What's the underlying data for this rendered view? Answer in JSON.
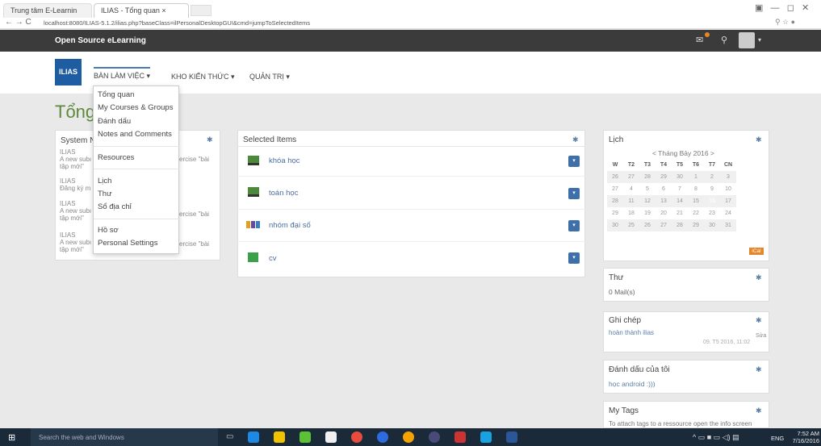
{
  "browser": {
    "tabs": [
      {
        "label": "Trung tâm E-Learnin",
        "active": false
      },
      {
        "label": "ILIAS - Tổng quan",
        "active": true
      }
    ],
    "url": "localhost:8080/ILIAS-5.1.2/ilias.php?baseClass=ilPersonalDesktopGUI&cmd=jumpToSelectedItems"
  },
  "app": {
    "title": "Open Source eLearning",
    "logo": "ILIAS",
    "page_title": "Tổng quan"
  },
  "nav": {
    "items": [
      {
        "label": "BÀN LÀM VIỆC ▾"
      },
      {
        "label": "KHO KIẾN THỨC ▾"
      },
      {
        "label": "QUẢN TRỊ ▾"
      }
    ]
  },
  "dropdown": {
    "group1": [
      "Tổng quan",
      "My Courses & Groups",
      "Đánh dấu",
      "Notes and Comments"
    ],
    "group2": [
      "Resources"
    ],
    "group3": [
      "Lịch",
      "Thư",
      "Sổ địa chỉ"
    ],
    "group4": [
      "Hồ sơ",
      "Personal Settings"
    ]
  },
  "system_panel": {
    "title": "System N",
    "entries": [
      {
        "l1": "ILIAS",
        "l2": "A new subı",
        "l3": "tập mới\"",
        "r": "ercise \"bài"
      },
      {
        "l1": "ILIAS",
        "l2": "Đăng ký m",
        "l3": "",
        "r": ""
      },
      {
        "l1": "ILIAS",
        "l2": "A new subı",
        "l3": "tập mới\"",
        "r": "ercise \"bài"
      },
      {
        "l1": "ILIAS",
        "l2": "A new subı",
        "l3": "tập mới\"",
        "r": "ercise \"bài"
      }
    ]
  },
  "selected_items": {
    "title": "Selected Items",
    "items": [
      {
        "label": "khóa học",
        "icon": "course-icon"
      },
      {
        "label": "toán học",
        "icon": "course-icon"
      },
      {
        "label": "nhóm đại số",
        "icon": "group-icon"
      },
      {
        "label": "cv",
        "icon": "folder-icon"
      }
    ]
  },
  "calendar": {
    "title": "Lịch",
    "month": "< Tháng Bảy 2016 >",
    "headers": [
      "W",
      "T2",
      "T3",
      "T4",
      "T5",
      "T6",
      "T7",
      "CN"
    ],
    "rows": [
      [
        "26",
        "27",
        "28",
        "29",
        "30",
        "1",
        "2",
        "3"
      ],
      [
        "27",
        "4",
        "5",
        "6",
        "7",
        "8",
        "9",
        "10"
      ],
      [
        "28",
        "11",
        "12",
        "13",
        "14",
        "15",
        "16",
        "17"
      ],
      [
        "29",
        "18",
        "19",
        "20",
        "21",
        "22",
        "23",
        "24"
      ],
      [
        "30",
        "25",
        "26",
        "27",
        "28",
        "29",
        "30",
        "31"
      ]
    ],
    "ical": "iCal"
  },
  "mail": {
    "title": "Thư",
    "text": "0 Mail(s)"
  },
  "notes": {
    "title": "Ghi chép",
    "text": "hoàn thành ilias",
    "edit": "Sửa",
    "date": "09. T5 2016, 11:02"
  },
  "bookmarks": {
    "title": "Đánh dấu của tôi",
    "text": "học android :)))"
  },
  "tags": {
    "title": "My Tags",
    "text": "To attach tags to a ressource open the info screen"
  },
  "taskbar": {
    "search": "Search the web and Windows",
    "lang": "ENG",
    "time": "7:52 AM",
    "date": "7/16/2016"
  }
}
